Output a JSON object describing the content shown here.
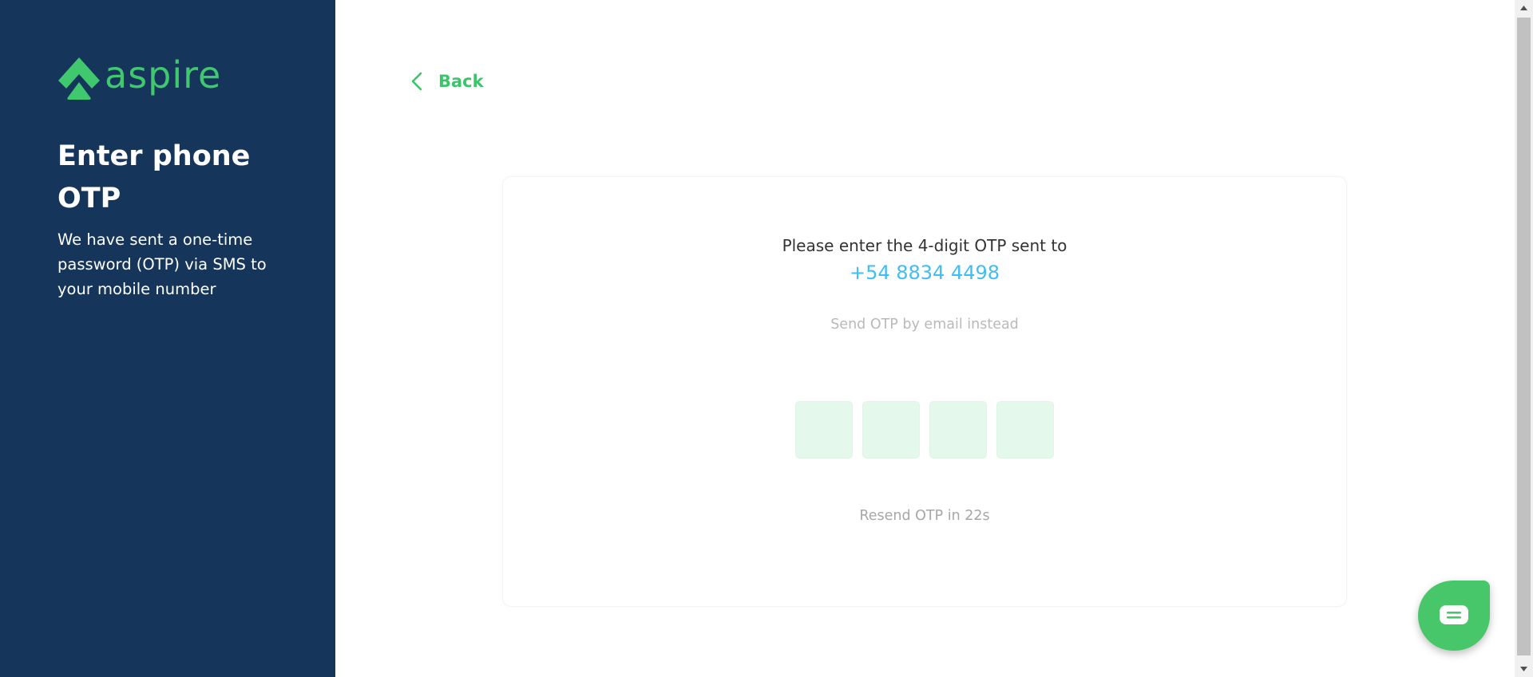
{
  "brand": {
    "name": "aspire",
    "color": "#40c86e"
  },
  "left_panel": {
    "background": "#15365a",
    "title": "Enter phone OTP",
    "description": "We have sent a one-time password (OTP) via SMS to your mobile number"
  },
  "back": {
    "label": "Back",
    "icon": "chevron-left-icon"
  },
  "otp_card": {
    "instruction": "Please enter the 4-digit OTP sent to",
    "phone_number": "+54 8834 4498",
    "email_alternative": "Send OTP by email instead",
    "digits": [
      "",
      "",
      "",
      ""
    ],
    "resend_text": "Resend OTP in 22s"
  },
  "chat": {
    "icon": "chat-icon",
    "color": "#47c76a"
  },
  "colors": {
    "accent_green": "#3cc46a",
    "phone_blue": "#3ebef3",
    "otp_box_fill": "#e5f8ec"
  }
}
